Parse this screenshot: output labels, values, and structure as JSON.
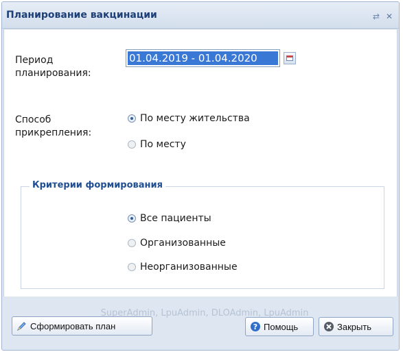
{
  "window": {
    "title": "Планирование вакцинации"
  },
  "form": {
    "period_label": "Период\nпланирования:",
    "period_value": "01.04.2019 - 01.04.2020",
    "attach_label": "Способ\nприкрепления:",
    "attach_options": [
      {
        "label": "По месту жительства",
        "selected": true
      },
      {
        "label": "По месту",
        "selected": false
      }
    ]
  },
  "criteria": {
    "legend": "Критерии формирования",
    "options": [
      {
        "label": "Все пациенты",
        "selected": true
      },
      {
        "label": "Организованные",
        "selected": false
      },
      {
        "label": "Неорганизованные",
        "selected": false
      }
    ]
  },
  "footer": {
    "watermark": "SuperAdmin, LpuAdmin, DLOAdmin, LpuAdmin",
    "form_button": "Сформировать план",
    "help_button": "Помощь",
    "close_button": "Закрыть"
  },
  "colors": {
    "accent": "#3a78d6",
    "title_text": "#1c3f78",
    "legend_text": "#1f4f92"
  }
}
